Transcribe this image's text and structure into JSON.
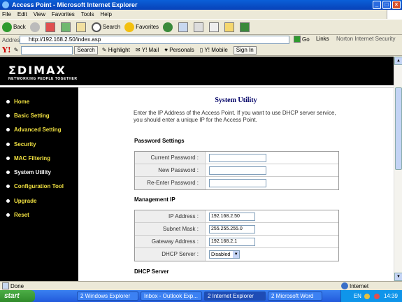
{
  "window": {
    "title": "Access Point - Microsoft Internet Explorer",
    "minimize": "_",
    "maximize": "□",
    "close": "×"
  },
  "menu": [
    "File",
    "Edit",
    "View",
    "Favorites",
    "Tools",
    "Help"
  ],
  "toolbar": {
    "back": "Back",
    "search": "Search",
    "favorites": "Favorites"
  },
  "address": {
    "label": "Address",
    "url": "http://192.168.2.50/index.asp",
    "go": "Go",
    "links": "Links",
    "security": "Norton Internet Security"
  },
  "yahoo_bar": {
    "logo": "Y!",
    "search": "Search",
    "highlight": "Highlight",
    "mail": "Y! Mail",
    "personals": "Personals",
    "mobile": "Y! Mobile",
    "signin": "Sign In"
  },
  "brand": {
    "logo": "ΣDIMAX",
    "tagline": "NETWORKING PEOPLE TOGETHER"
  },
  "nav": [
    {
      "label": "Home"
    },
    {
      "label": "Basic Setting"
    },
    {
      "label": "Advanced Setting"
    },
    {
      "label": "Security"
    },
    {
      "label": "MAC Filtering"
    },
    {
      "label": "System Utility",
      "active": true
    },
    {
      "label": "Configuration Tool"
    },
    {
      "label": "Upgrade"
    },
    {
      "label": "Reset"
    }
  ],
  "page": {
    "title": "System Utility",
    "intro": "Enter the IP Address of the Access Point. If you want to use DHCP server service, you should enter a unique IP for the Access Point.",
    "password_section": "Password Settings",
    "current_password_label": "Current Password :",
    "new_password_label": "New Password :",
    "reenter_password_label": "Re-Enter Password :",
    "management_section": "Management IP",
    "ip_label": "IP Address :",
    "ip_value": "192.168.2.50",
    "mask_label": "Subnet Mask :",
    "mask_value": "255.255.255.0",
    "gateway_label": "Gateway Address :",
    "gateway_value": "192.168.2.1",
    "dhcp_label": "DHCP Server :",
    "dhcp_value": "Disabled",
    "dhcp_section": "DHCP Server"
  },
  "status": {
    "text": "Done",
    "zone": "Internet"
  },
  "taskbar": {
    "start": "start",
    "tasks": [
      "2 Windows Explorer",
      "Inbox - Outlook Exp...",
      "2 Internet Explorer",
      "2 Microsoft Word"
    ],
    "lang": "EN",
    "time": "14:39"
  }
}
